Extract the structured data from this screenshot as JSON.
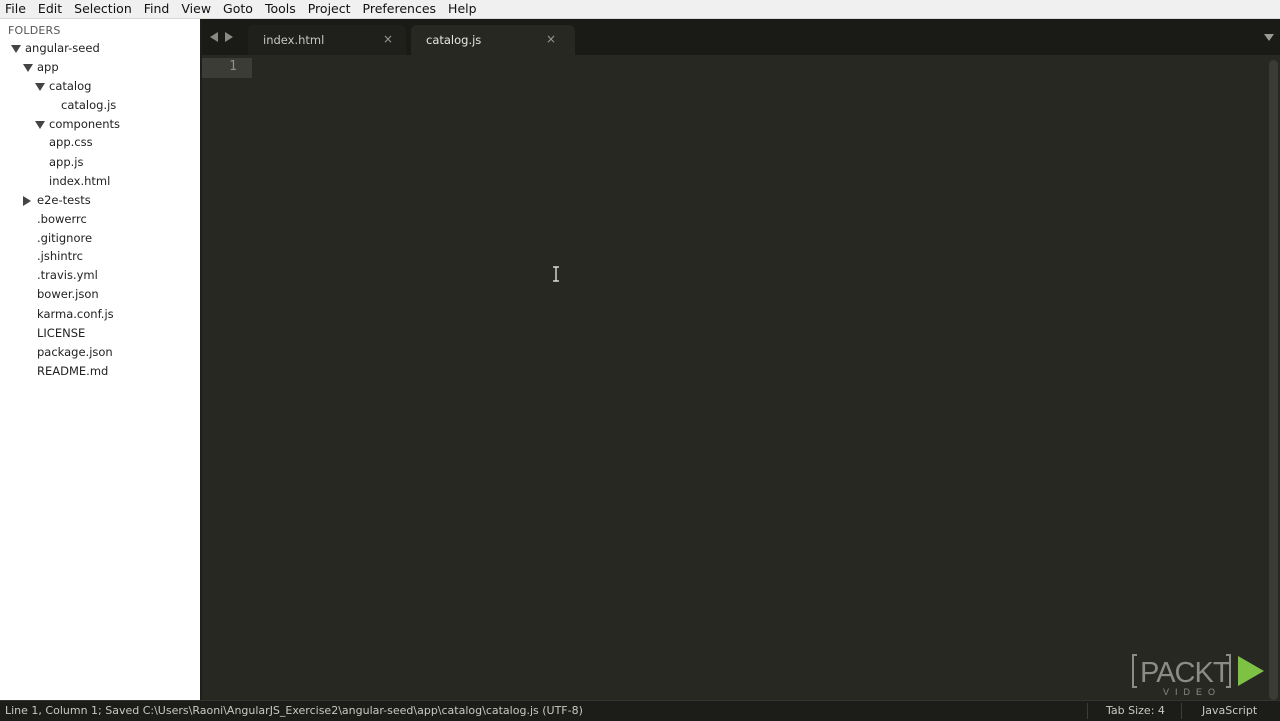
{
  "menu": [
    "File",
    "Edit",
    "Selection",
    "Find",
    "View",
    "Goto",
    "Tools",
    "Project",
    "Preferences",
    "Help"
  ],
  "sidebar": {
    "header": "FOLDERS",
    "tree": [
      {
        "label": "angular-seed",
        "state": "expanded"
      },
      {
        "label": "app",
        "state": "expanded"
      },
      {
        "label": "catalog",
        "state": "expanded"
      },
      {
        "label": "catalog.js",
        "state": "file"
      },
      {
        "label": "components",
        "state": "expanded"
      },
      {
        "label": "app.css",
        "state": "file"
      },
      {
        "label": "app.js",
        "state": "file"
      },
      {
        "label": "index.html",
        "state": "file"
      },
      {
        "label": "e2e-tests",
        "state": "collapsed"
      },
      {
        "label": ".bowerrc",
        "state": "file"
      },
      {
        "label": ".gitignore",
        "state": "file"
      },
      {
        "label": ".jshintrc",
        "state": "file"
      },
      {
        "label": ".travis.yml",
        "state": "file"
      },
      {
        "label": "bower.json",
        "state": "file"
      },
      {
        "label": "karma.conf.js",
        "state": "file"
      },
      {
        "label": "LICENSE",
        "state": "file"
      },
      {
        "label": "package.json",
        "state": "file"
      },
      {
        "label": "README.md",
        "state": "file"
      }
    ]
  },
  "tabs": [
    {
      "label": "index.html",
      "close": "×",
      "active": false
    },
    {
      "label": "catalog.js",
      "close": "×",
      "active": true
    }
  ],
  "editor": {
    "line_numbers": [
      "1"
    ]
  },
  "watermark": {
    "brand": "PACKT",
    "sub": "VIDEO",
    "arrow_color": "#7dc243"
  },
  "status": {
    "text": "Line 1, Column 1; Saved C:\\Users\\Raoni\\AngularJS_Exercise2\\angular-seed\\app\\catalog\\catalog.js (UTF-8)",
    "tab_size": "Tab Size: 4",
    "syntax": "JavaScript"
  },
  "colors": {
    "editor_bg": "#272822",
    "sidebar_bg": "#ffffff",
    "tabbar_bg": "#1a1a17"
  }
}
